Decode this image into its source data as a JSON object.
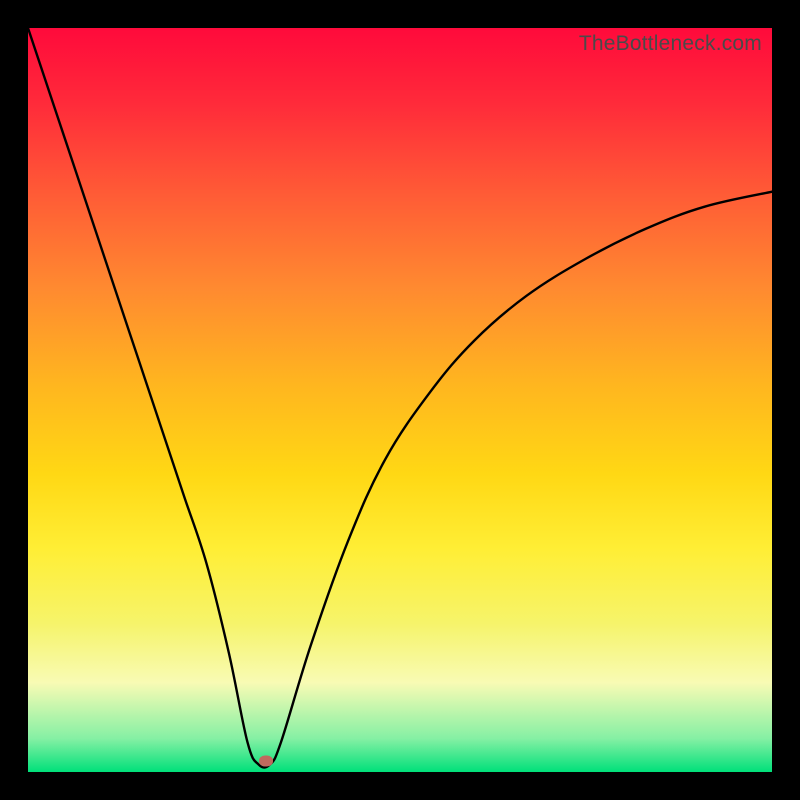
{
  "watermark": "TheBottleneck.com",
  "chart_data": {
    "type": "line",
    "title": "",
    "xlabel": "",
    "ylabel": "",
    "xlim": [
      0,
      100
    ],
    "ylim": [
      0,
      100
    ],
    "x": [
      0,
      3,
      6,
      9,
      12,
      15,
      18,
      21,
      24,
      27,
      29.5,
      31,
      32.5,
      34,
      38,
      43,
      48,
      54,
      60,
      67,
      75,
      83,
      91,
      100
    ],
    "values": [
      100,
      91,
      82,
      73,
      64,
      55,
      46,
      37,
      28,
      16,
      4,
      1,
      1,
      4,
      17,
      31,
      42,
      51,
      58,
      64,
      69,
      73,
      76,
      78
    ],
    "marker": {
      "x": 32,
      "y": 1.5
    },
    "gradient_stops": [
      {
        "pos": 0,
        "color": "#ff0a3b"
      },
      {
        "pos": 0.48,
        "color": "#ffd814"
      },
      {
        "pos": 0.88,
        "color": "#f8fbb4"
      },
      {
        "pos": 1.0,
        "color": "#00e07a"
      }
    ]
  }
}
